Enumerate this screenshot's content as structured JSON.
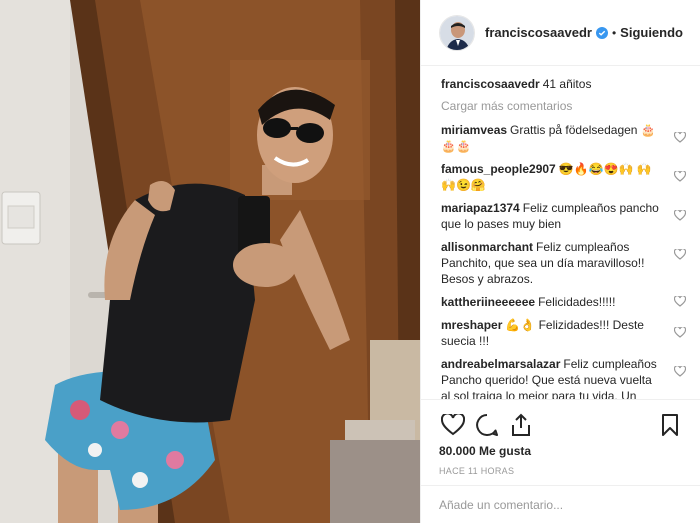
{
  "post": {
    "author": "franciscosaavedr",
    "follow_status": "Siguiendo",
    "separator": "•"
  },
  "comments": {
    "caption": {
      "user": "franciscosaavedr",
      "text": "41 añitos"
    },
    "load_more": "Cargar más comentarios",
    "items": [
      {
        "user": "miriamveas",
        "text": "Grattis på födelsedagen 🎂 🎂🎂"
      },
      {
        "user": "famous_people2907",
        "text": "😎🔥😂😍🙌 🙌🙌😉🤗"
      },
      {
        "user": "mariapaz1374",
        "text": "Feliz cumpleaños pancho que lo pases muy bien"
      },
      {
        "user": "allisonmarchant",
        "text": "Feliz cumpleaños Panchito, que sea un día maravilloso!! Besos y abrazos."
      },
      {
        "user": "kattheriineeeeee",
        "text": "Felicidades!!!!!"
      },
      {
        "user": "mreshaper",
        "text": "💪👌 Felizidades!!! Deste suecia !!!"
      },
      {
        "user": "andreabelmarsalazar",
        "text": "Feliz cumpleaños Pancho querido! Que está nueva vuelta al sol traiga lo mejor para tu vida. Un"
      }
    ]
  },
  "actions": {
    "likes": "80.000 Me gusta",
    "time": "HACE 11 HORAS"
  },
  "composer": {
    "placeholder": "Añade un comentario..."
  },
  "colors": {
    "verified": "#3897f0",
    "muted": "#999999",
    "text": "#262626"
  }
}
